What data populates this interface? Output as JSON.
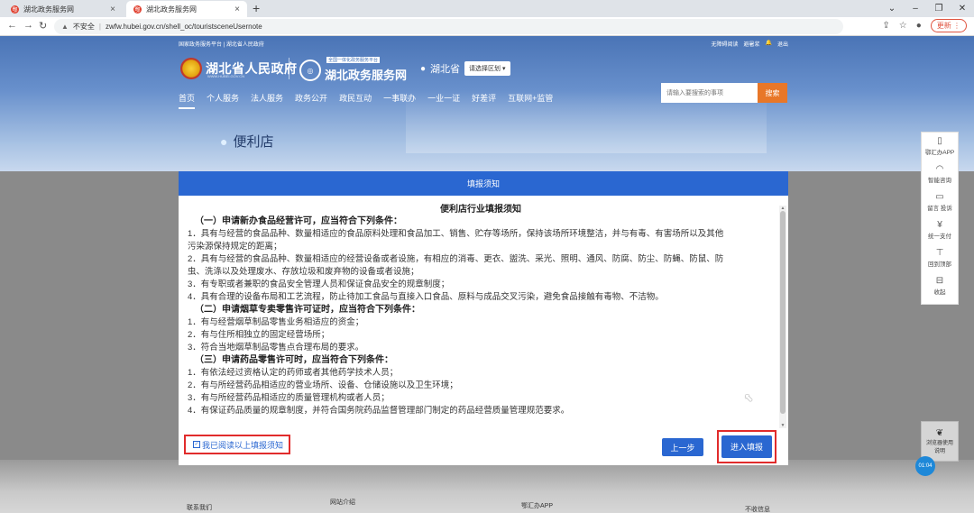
{
  "browser": {
    "tabs": [
      {
        "title": "湖北政务服务网"
      },
      {
        "title": "湖北政务服务网"
      }
    ],
    "url_warning": "不安全",
    "url": "zwfw.hubei.gov.cn/shell_oc/touristsceneUsernote",
    "update_label": "更新"
  },
  "header": {
    "top_left": "国家政务服务平台 | 湖北省人民政府",
    "top_right": [
      "无障碍阅读",
      "避暑浆",
      "退出"
    ],
    "gov_name": "湖北省人民政府",
    "gov_sub": "WWW.HUBEI.GOV.CN",
    "platform_tag": "全国一体化政务服务平台",
    "platform_name": "湖北政务服务网",
    "province": "湖北省",
    "region_select": "请选择区划",
    "nav": [
      "首页",
      "个人服务",
      "法人服务",
      "政务公开",
      "政民互动",
      "一事联办",
      "一业一证",
      "好差评",
      "互联网+监管"
    ],
    "search_placeholder": "请输入要搜索的事项",
    "search_btn": "搜索",
    "store_title": "便利店"
  },
  "modal": {
    "header": "填报须知",
    "doc_title": "便利店行业填报须知",
    "lines": [
      {
        "t": "sec",
        "text": "（一）申请新办食品经营许可，应当符合下列条件："
      },
      {
        "t": "item",
        "text": "1．具有与经营的食品品种、数量相适应的食品原料处理和食品加工、销售、贮存等场所，保持该场所环境整洁，并与有毒、有害场所以及其他"
      },
      {
        "t": "item",
        "text": "污染源保持规定的距离；"
      },
      {
        "t": "item",
        "text": "2．具有与经营的食品品种、数量相适应的经营设备或者设施，有相应的消毒、更衣、盥洗、采光、照明、通风、防腐、防尘、防蝇、防鼠、防"
      },
      {
        "t": "item",
        "text": "虫、洗涤以及处理废水、存放垃圾和废弃物的设备或者设施；"
      },
      {
        "t": "item",
        "text": "3．有专职或者兼职的食品安全管理人员和保证食品安全的规章制度；"
      },
      {
        "t": "item",
        "text": "4．具有合理的设备布局和工艺流程，防止待加工食品与直接入口食品、原料与成品交叉污染，避免食品接触有毒物、不洁物。"
      },
      {
        "t": "sec",
        "text": "（二）申请烟草专卖零售许可证时，应当符合下列条件："
      },
      {
        "t": "item",
        "text": "1．有与经营烟草制品零售业务相适应的资金；"
      },
      {
        "t": "item",
        "text": "2．有与住所相独立的固定经营场所；"
      },
      {
        "t": "item",
        "text": "3．符合当地烟草制品零售点合理布局的要求。"
      },
      {
        "t": "sec",
        "text": "（三）申请药品零售许可时，应当符合下列条件："
      },
      {
        "t": "item",
        "text": "1．有依法经过资格认定的药师或者其他药学技术人员；"
      },
      {
        "t": "item",
        "text": "2．有与所经营药品相适应的营业场所、设备、仓储设施以及卫生环境；"
      },
      {
        "t": "item",
        "text": "3．有与所经营药品相适应的质量管理机构或者人员；"
      },
      {
        "t": "item",
        "text": "4．有保证药品质量的规章制度，并符合国务院药品监督管理部门制定的药品经营质量管理规范要求。"
      }
    ],
    "agree_label": "我已阅读以上填报须知",
    "prev_label": "上一步",
    "next_label": "进入填报"
  },
  "sidebar": [
    {
      "icon": "phone-icon",
      "label": "鄂汇办APP"
    },
    {
      "icon": "headset-icon",
      "label": "智能咨询"
    },
    {
      "icon": "message-icon",
      "label": "留言 投诉"
    },
    {
      "icon": "yuan-icon",
      "label": "统一支付"
    },
    {
      "icon": "top-icon",
      "label": "回到顶部"
    },
    {
      "icon": "collapse-icon",
      "label": "收起"
    }
  ],
  "side_bottom": "浏览器使用说明",
  "clock": "01:04",
  "footer": {
    "contact": "联系我们",
    "site_intro": "网站介绍",
    "app": "鄂汇办APP",
    "letter": "不收信息"
  }
}
